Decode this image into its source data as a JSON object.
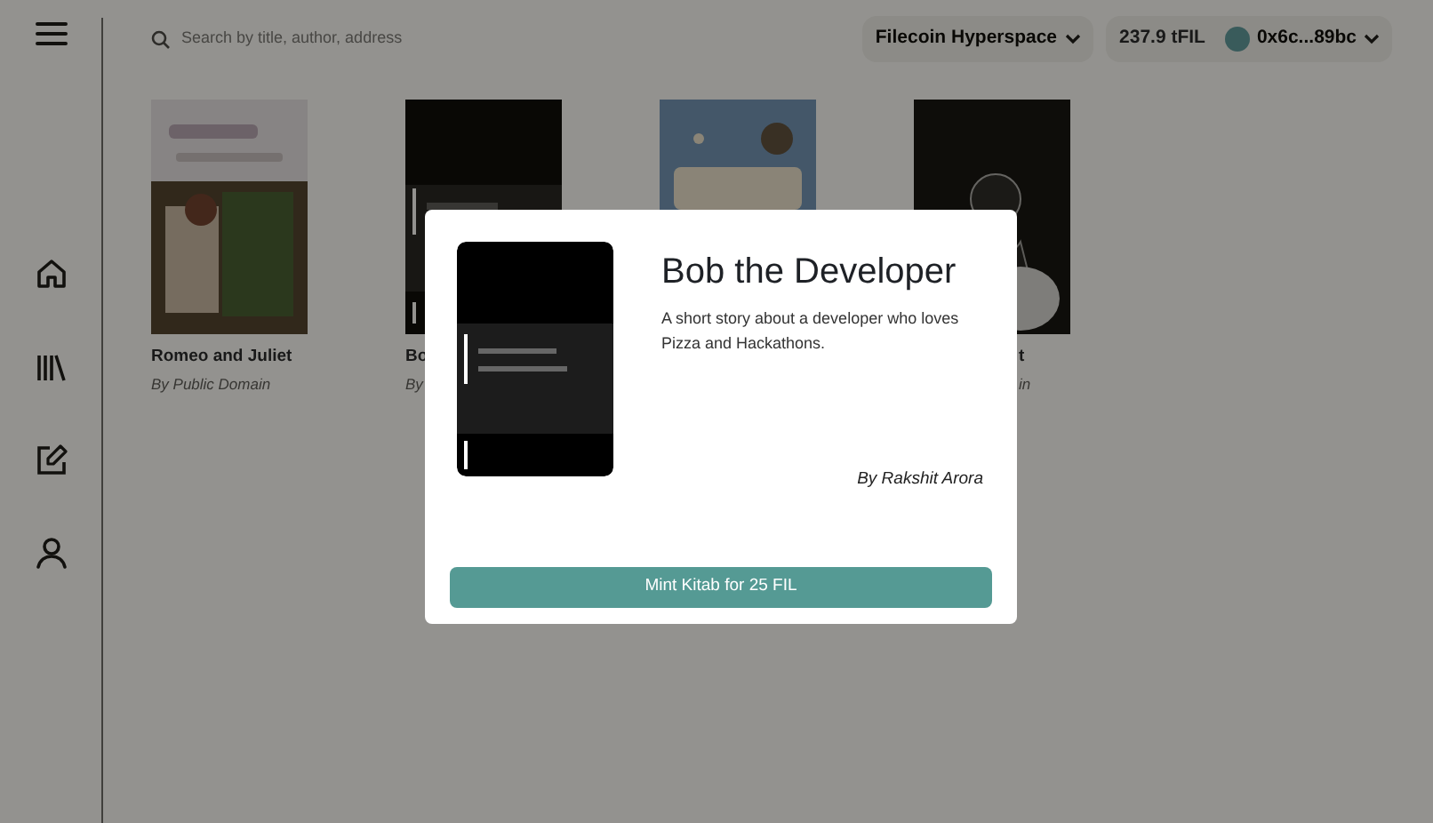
{
  "search": {
    "placeholder": "Search by title, author, address"
  },
  "network": {
    "label": "Filecoin Hyperspace"
  },
  "wallet": {
    "balance": "237.9 tFIL",
    "account": "0x6c...89bc"
  },
  "books": [
    {
      "kind": "picture",
      "title": "Romeo and Juliet",
      "author": "By Public Domain"
    },
    {
      "kind": "picture",
      "title": "Bo",
      "author": "By"
    },
    {
      "kind": "picture"
    },
    {
      "kind": "picture",
      "title": "t",
      "author": "in"
    }
  ],
  "modal": {
    "title": "Bob the Developer",
    "description": "A short story about a developer who loves Pizza and Hackathons.",
    "author": "By Rakshit Arora",
    "button": "Mint Kitab for 25 FIL"
  }
}
